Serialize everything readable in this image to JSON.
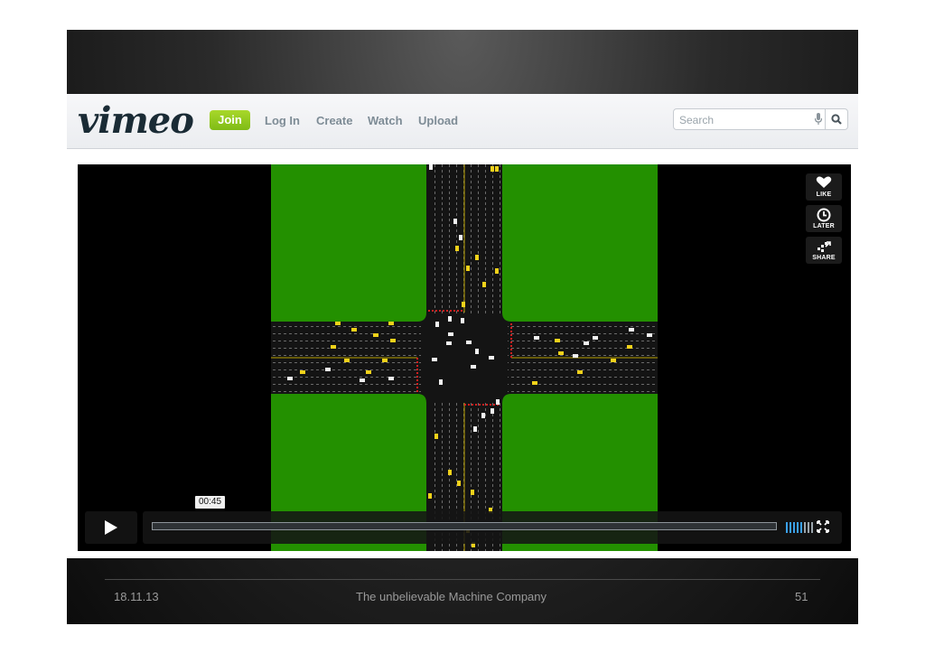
{
  "vimeo": {
    "logo": "vimeo",
    "join_label": "Join",
    "nav": [
      "Log In",
      "Create",
      "Watch",
      "Upload"
    ],
    "search_placeholder": "Search",
    "icons": {
      "mic": "mic-icon",
      "search": "search-icon"
    },
    "colors": {
      "join": "#8cc51f",
      "nav": "#7e8c96",
      "logo": "#1a2b35"
    }
  },
  "player": {
    "actions": [
      {
        "label": "LIKE",
        "icon": "heart-icon"
      },
      {
        "label": "LATER",
        "icon": "clock-icon"
      },
      {
        "label": "SHARE",
        "icon": "share-icon"
      }
    ],
    "time": "00:45",
    "icons": {
      "play": "play-icon",
      "volume": "volume-icon",
      "fullscreen": "fullscreen-icon"
    },
    "colors": {
      "grass": "#239000",
      "road": "#141414",
      "volume": "#3aa0e8"
    }
  },
  "footer": {
    "date": "18.11.13",
    "company": "The unbelievable Machine Company",
    "page": "51"
  }
}
